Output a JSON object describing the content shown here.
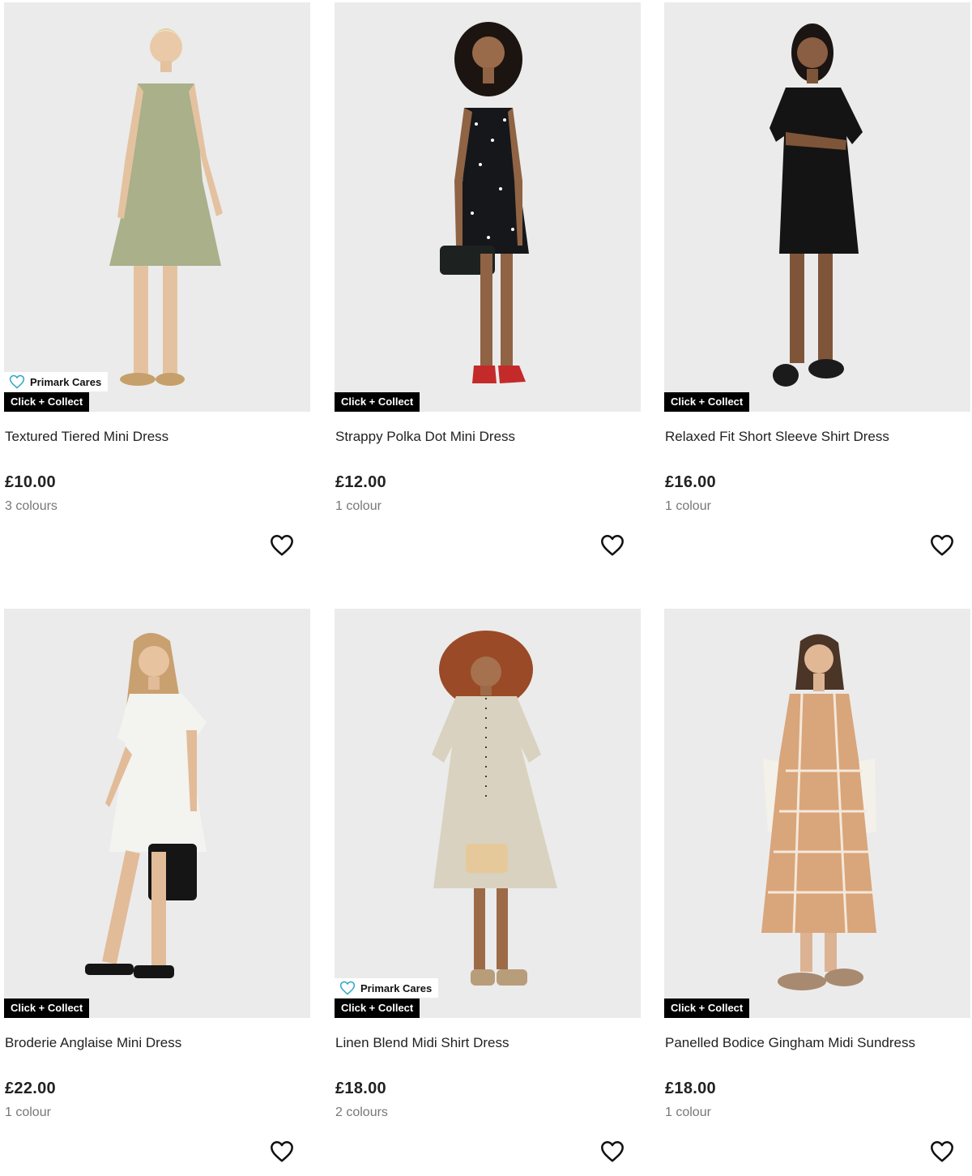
{
  "colors": {
    "badge_bg": "#000000",
    "badge_text": "#ffffff",
    "cares_heart": "#2aa6c4",
    "image_bg": "#ebebeb"
  },
  "icons": {
    "wishlist": "heart-outline-icon",
    "primark_cares": "heart-icon"
  },
  "products": [
    {
      "title": "Textured Tiered Mini Dress",
      "price": "£10.00",
      "colours": "3 colours",
      "primark_cares": "Primark Cares",
      "click_collect": "Click + Collect",
      "dress_color": "#a9b08a",
      "shoe_color": "#c6a06a"
    },
    {
      "title": "Strappy Polka Dot Mini Dress",
      "price": "£12.00",
      "colours": "1 colour",
      "click_collect": "Click + Collect",
      "dress_color": "#15171a",
      "shoe_color": "#c42a2a"
    },
    {
      "title": "Relaxed Fit Short Sleeve Shirt Dress",
      "price": "£16.00",
      "colours": "1 colour",
      "click_collect": "Click + Collect",
      "dress_color": "#141414",
      "shoe_color": "#1b1b1b"
    },
    {
      "title": "Broderie Anglaise Mini Dress",
      "price": "£22.00",
      "colours": "1 colour",
      "click_collect": "Click + Collect",
      "dress_color": "#f3f3ef",
      "shoe_color": "#151515"
    },
    {
      "title": "Linen Blend Midi Shirt Dress",
      "price": "£18.00",
      "colours": "2 colours",
      "primark_cares": "Primark Cares",
      "click_collect": "Click + Collect",
      "dress_color": "#d9d2c0",
      "shoe_color": "#b79d7a"
    },
    {
      "title": "Panelled Bodice Gingham Midi Sundress",
      "price": "£18.00",
      "colours": "1 colour",
      "click_collect": "Click + Collect",
      "dress_color": "#d9a57a",
      "shoe_color": "#a88a70"
    }
  ]
}
